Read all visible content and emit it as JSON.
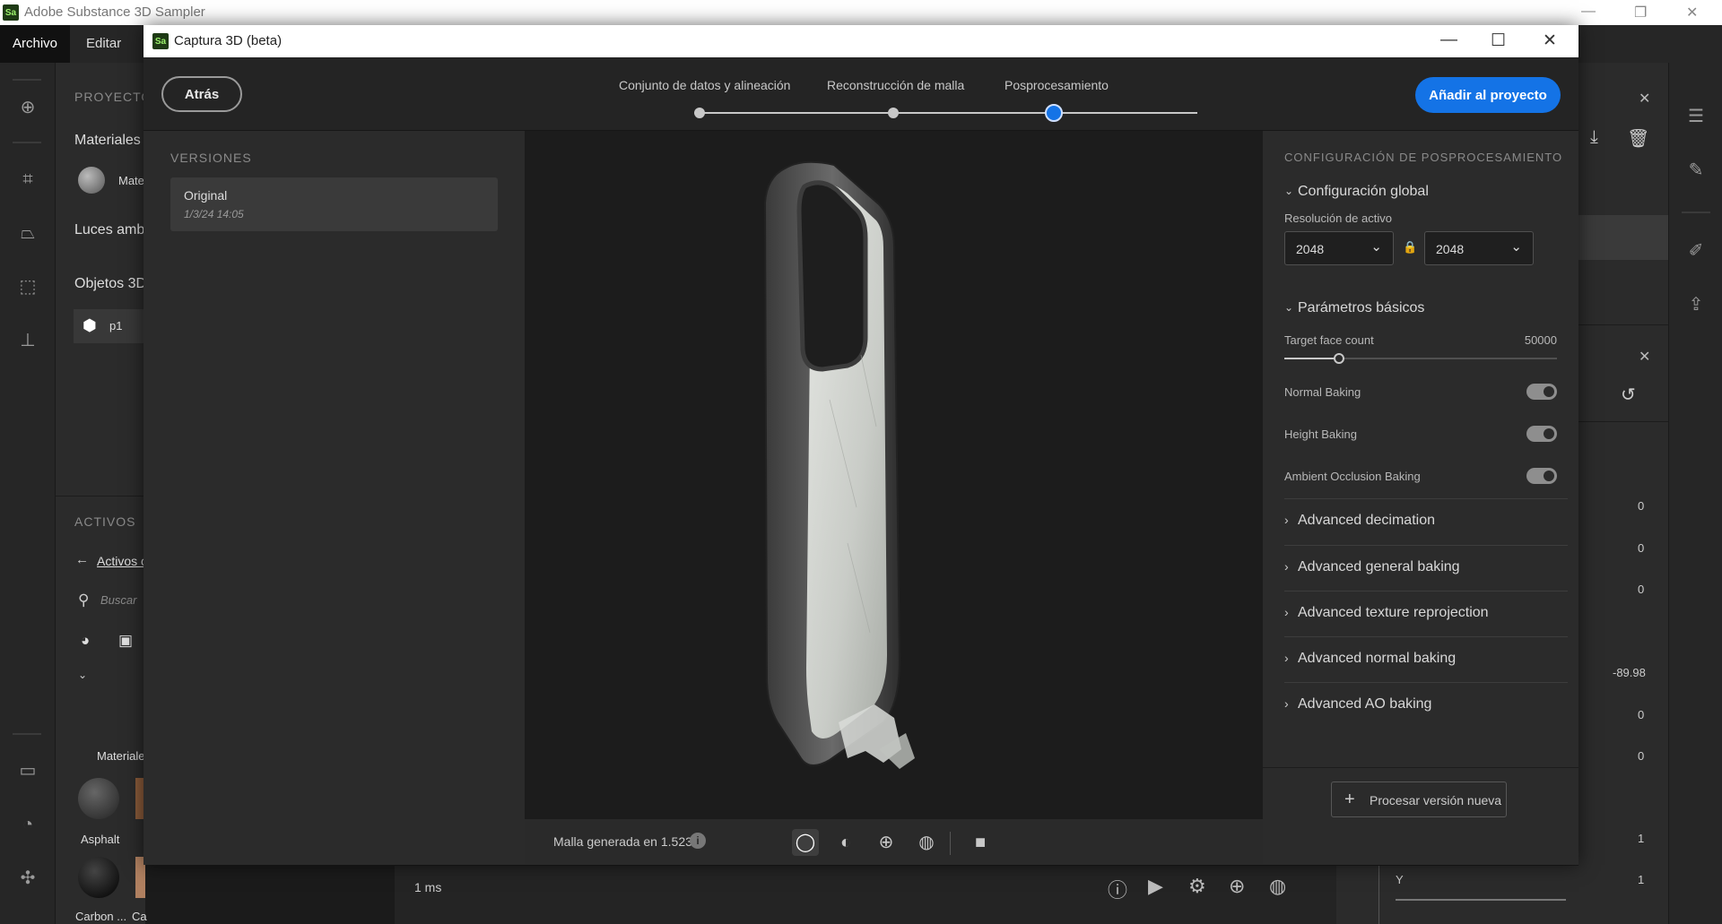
{
  "app": {
    "logo": "Sa",
    "title": "Adobe Substance 3D Sampler",
    "menu": [
      "Archivo",
      "Editar"
    ]
  },
  "project_panel": {
    "section": "PROYECTO",
    "materials": "Materiales",
    "material_item": "Mate",
    "lights": "Luces amb",
    "objects": "Objetos 3D",
    "object_item": "p1",
    "assets_section": "ACTIVOS",
    "assets_link": "Activos c",
    "search_placeholder": "Buscar",
    "materials_group": "Materiale",
    "asset_names": [
      "Asphalt",
      "Carbon ...",
      "Ca"
    ]
  },
  "dialog": {
    "logo": "Sa",
    "title": "Captura 3D (beta)",
    "back_label": "Atrás",
    "add_label": "Añadir al proyecto",
    "steps": [
      "Conjunto de datos y alineación",
      "Reconstrucción de malla",
      "Posprocesamiento"
    ],
    "current_step": 3
  },
  "versions": {
    "header": "VERSIONES",
    "items": [
      {
        "name": "Original",
        "date": "1/3/24 14:05"
      }
    ]
  },
  "viewport": {
    "status": "Malla generada en 1.523s",
    "icons": [
      "solid-view-icon",
      "material-view-icon",
      "wireframe-view-icon",
      "texture-view-icon",
      "camera-icon"
    ]
  },
  "settings": {
    "header": "CONFIGURACIÓN DE POSPROCESAMIENTO",
    "global_section": "Configuración global",
    "resolution_label": "Resolución de activo",
    "resolution_w": "2048",
    "resolution_h": "2048",
    "basic_section": "Parámetros básicos",
    "target_face_label": "Target face count",
    "target_face_value": "50000",
    "target_face_fraction": 0.2,
    "toggles": [
      {
        "label": "Normal Baking",
        "on": true
      },
      {
        "label": "Height Baking",
        "on": true
      },
      {
        "label": "Ambient Occlusion Baking",
        "on": true
      }
    ],
    "advanced": [
      "Advanced decimation",
      "Advanced general baking",
      "Advanced texture reprojection",
      "Advanced normal baking",
      "Advanced AO baking"
    ],
    "process_label": "Procesar versión nueva"
  },
  "background": {
    "right_values": [
      "0",
      "0",
      "0",
      "-89.98",
      "0",
      "0",
      "1",
      "1"
    ],
    "y_label": "Y",
    "render_time": "1 ms"
  },
  "colors": {
    "accent": "#1473e6",
    "panel": "#2b2b2b",
    "viewport": "#1c1c1c"
  }
}
